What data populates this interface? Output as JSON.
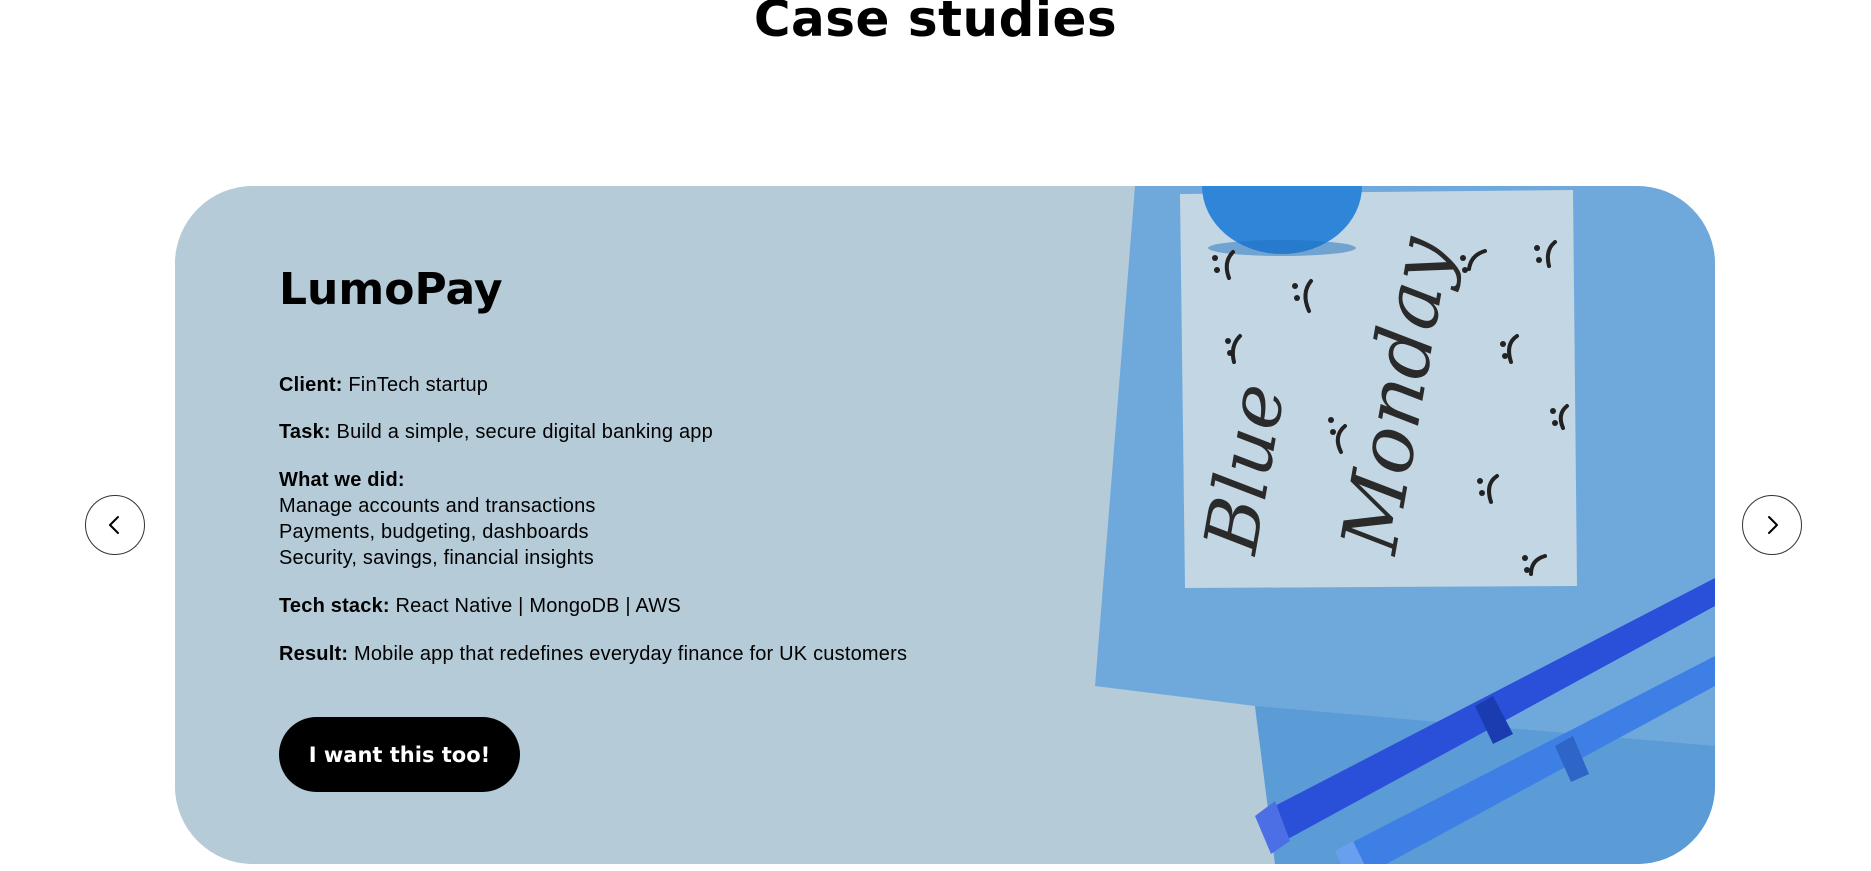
{
  "section": {
    "title": "Case studies"
  },
  "case": {
    "title": "LumoPay",
    "client_label": "Client:",
    "client_value": "FinTech startup",
    "task_label": "Task:",
    "task_value": "Build a simple, secure digital banking app",
    "did_label": "What we did:",
    "did_items": [
      "Manage accounts and transactions",
      "Payments, budgeting, dashboards",
      "Security, savings, financial insights"
    ],
    "stack_label": "Tech stack:",
    "stack_value": "React Native | MongoDB | AWS",
    "result_label": "Result:",
    "result_value": "Mobile app that redefines everyday finance for UK customers",
    "cta_label": "I want this too!",
    "image": {
      "note_text_1": "Blue",
      "note_text_2": "Monday"
    }
  },
  "nav": {
    "prev_icon": "chevron-left-icon",
    "next_icon": "chevron-right-icon"
  },
  "colors": {
    "card_bg": "#b6ccd9",
    "paper_blue": "#6aa6dc",
    "cta_bg": "#000000",
    "cta_text": "#ffffff"
  }
}
